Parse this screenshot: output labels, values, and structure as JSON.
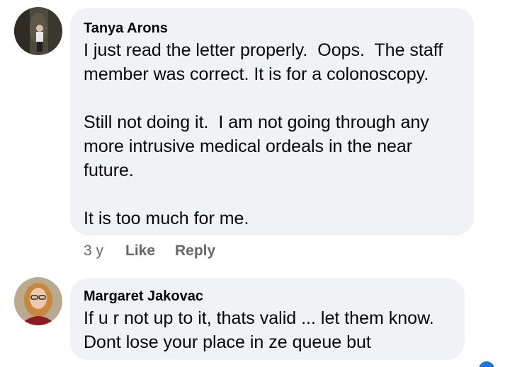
{
  "comments": [
    {
      "author": "Tanya Arons",
      "paragraphs": [
        "I just read the letter properly.  Oops.  The staff member was correct. It is for a colonoscopy.",
        "Still not doing it.  I am not going through any more intrusive medical ordeals in the near future.",
        "It is too much for me."
      ],
      "time": "3 y",
      "like_label": "Like",
      "reply_label": "Reply"
    },
    {
      "author": "Margaret Jakovac",
      "paragraphs": [
        "If u r not up to it, thats valid ... let them know. Dont lose your place in ze queue but"
      ]
    }
  ],
  "colors": {
    "bubble": "#f0f2f5",
    "secondary_text": "#65676b",
    "accent": "#1b74e4"
  },
  "icons": {
    "avatar_1": "profile-photo-tanya-arons",
    "avatar_2": "profile-photo-margaret-jakovac",
    "corner": "blue-circle-badge"
  }
}
